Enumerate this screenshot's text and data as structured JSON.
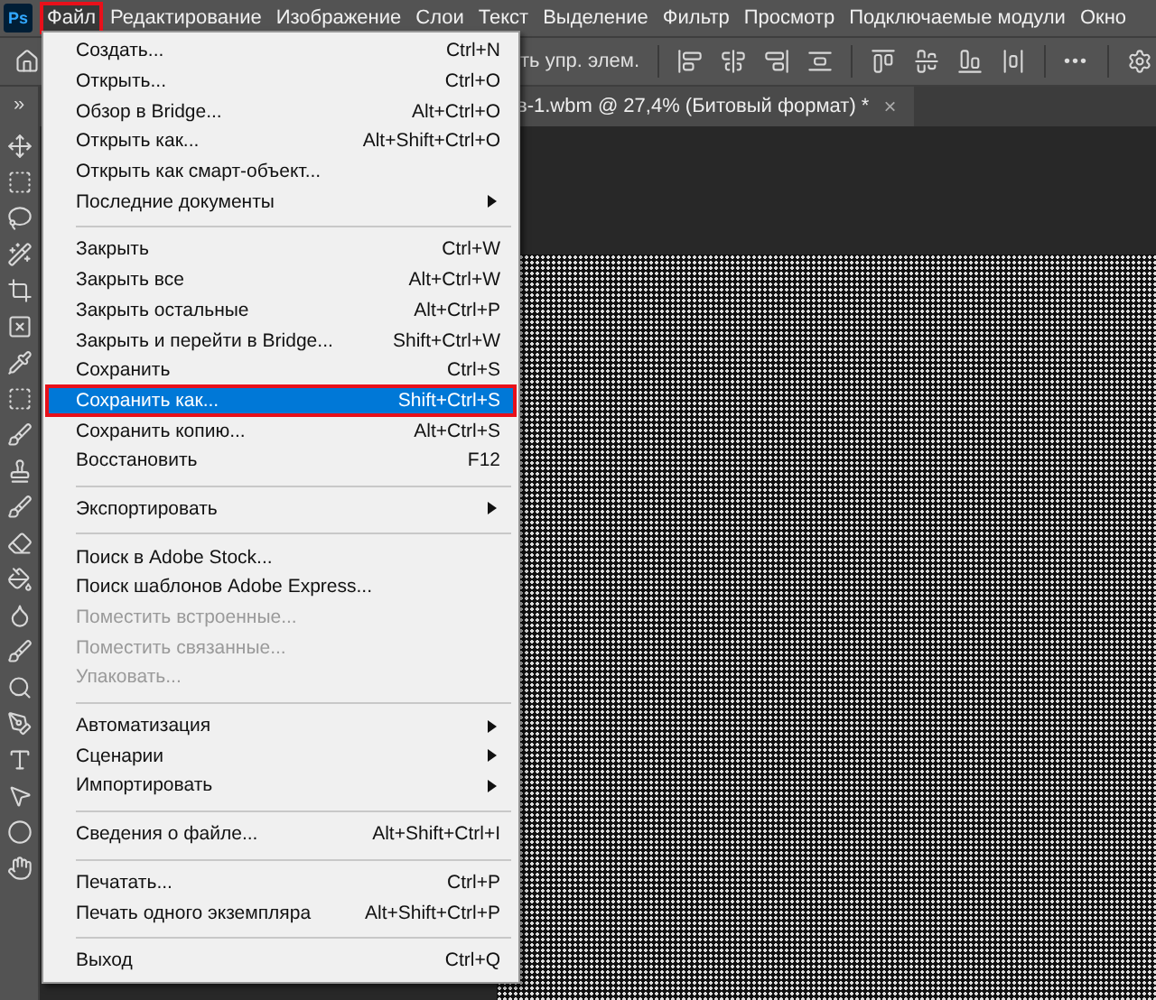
{
  "app_logo": "Ps",
  "menubar": [
    {
      "label": "Файл",
      "selected": true
    },
    {
      "label": "Редактирование",
      "selected": false
    },
    {
      "label": "Изображение",
      "selected": false
    },
    {
      "label": "Слои",
      "selected": false
    },
    {
      "label": "Текст",
      "selected": false
    },
    {
      "label": "Выделение",
      "selected": false
    },
    {
      "label": "Фильтр",
      "selected": false
    },
    {
      "label": "Просмотр",
      "selected": false
    },
    {
      "label": "Подключаемые модули",
      "selected": false
    },
    {
      "label": "Окно",
      "selected": false
    }
  ],
  "options_bar": {
    "text": "ть упр. элем.",
    "more": "•••"
  },
  "panel_toggle": "»",
  "document_tab": {
    "title": "в-1.wbm @ 27,4% (Битовый формат) *",
    "close": "×"
  },
  "file_menu": [
    [
      {
        "label": "Создать...",
        "shortcut": "Ctrl+N",
        "disabled": false,
        "submenu": false,
        "selected": false
      },
      {
        "label": "Открыть...",
        "shortcut": "Ctrl+O",
        "disabled": false,
        "submenu": false,
        "selected": false
      },
      {
        "label": "Обзор в Bridge...",
        "shortcut": "Alt+Ctrl+O",
        "disabled": false,
        "submenu": false,
        "selected": false
      },
      {
        "label": "Открыть как...",
        "shortcut": "Alt+Shift+Ctrl+O",
        "disabled": false,
        "submenu": false,
        "selected": false
      },
      {
        "label": "Открыть как смарт-объект...",
        "disabled": false,
        "submenu": false,
        "selected": false
      },
      {
        "label": "Последние документы",
        "disabled": false,
        "submenu": true,
        "selected": false
      }
    ],
    [
      {
        "label": "Закрыть",
        "shortcut": "Ctrl+W",
        "disabled": false,
        "submenu": false,
        "selected": false
      },
      {
        "label": "Закрыть все",
        "shortcut": "Alt+Ctrl+W",
        "disabled": false,
        "submenu": false,
        "selected": false
      },
      {
        "label": "Закрыть остальные",
        "shortcut": "Alt+Ctrl+P",
        "disabled": false,
        "submenu": false,
        "selected": false
      },
      {
        "label": "Закрыть и перейти в Bridge...",
        "shortcut": "Shift+Ctrl+W",
        "disabled": false,
        "submenu": false,
        "selected": false
      },
      {
        "label": "Сохранить",
        "shortcut": "Ctrl+S",
        "disabled": false,
        "submenu": false,
        "selected": false
      },
      {
        "label": "Сохранить как...",
        "shortcut": "Shift+Ctrl+S",
        "disabled": false,
        "submenu": false,
        "selected": true
      },
      {
        "label": "Сохранить копию...",
        "shortcut": "Alt+Ctrl+S",
        "disabled": false,
        "submenu": false,
        "selected": false
      },
      {
        "label": "Восстановить",
        "shortcut": "F12",
        "disabled": false,
        "submenu": false,
        "selected": false
      }
    ],
    [
      {
        "label": "Экспортировать",
        "disabled": false,
        "submenu": true,
        "selected": false
      }
    ],
    [
      {
        "label": "Поиск в Adobe Stock...",
        "disabled": false,
        "submenu": false,
        "selected": false
      },
      {
        "label": "Поиск шаблонов Adobe Express...",
        "disabled": false,
        "submenu": false,
        "selected": false
      },
      {
        "label": "Поместить встроенные...",
        "disabled": true,
        "submenu": false,
        "selected": false
      },
      {
        "label": "Поместить связанные...",
        "disabled": true,
        "submenu": false,
        "selected": false
      },
      {
        "label": "Упаковать...",
        "disabled": true,
        "submenu": false,
        "selected": false
      }
    ],
    [
      {
        "label": "Автоматизация",
        "disabled": false,
        "submenu": true,
        "selected": false
      },
      {
        "label": "Сценарии",
        "disabled": false,
        "submenu": true,
        "selected": false
      },
      {
        "label": "Импортировать",
        "disabled": false,
        "submenu": true,
        "selected": false
      }
    ],
    [
      {
        "label": "Сведения о файле...",
        "shortcut": "Alt+Shift+Ctrl+I",
        "disabled": false,
        "submenu": false,
        "selected": false
      }
    ],
    [
      {
        "label": "Печатать...",
        "shortcut": "Ctrl+P",
        "disabled": false,
        "submenu": false,
        "selected": false
      },
      {
        "label": "Печать одного экземпляра",
        "shortcut": "Alt+Shift+Ctrl+P",
        "disabled": false,
        "submenu": false,
        "selected": false
      }
    ],
    [
      {
        "label": "Выход",
        "shortcut": "Ctrl+Q",
        "disabled": false,
        "submenu": false,
        "selected": false
      }
    ]
  ]
}
